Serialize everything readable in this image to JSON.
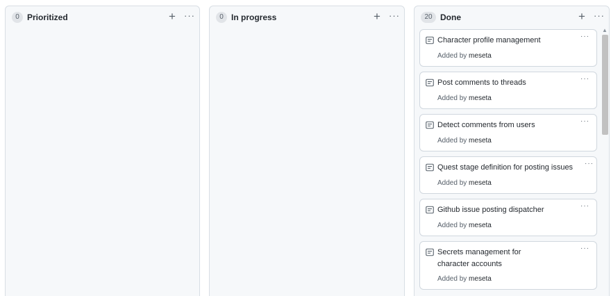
{
  "columns": [
    {
      "count": "0",
      "title": "Prioritized",
      "add": "+",
      "more": "···",
      "cards": []
    },
    {
      "count": "0",
      "title": "In progress",
      "add": "+",
      "more": "···",
      "cards": []
    },
    {
      "count": "20",
      "title": "Done",
      "add": "+",
      "more": "···",
      "cards": [
        {
          "title": "Character profile management",
          "added_by_label": "Added by",
          "author": "meseta",
          "menu": "···"
        },
        {
          "title": "Post comments to threads",
          "added_by_label": "Added by",
          "author": "meseta",
          "menu": "···"
        },
        {
          "title": "Detect comments from users",
          "added_by_label": "Added by",
          "author": "meseta",
          "menu": "···"
        },
        {
          "title": "Quest stage definition for posting issues",
          "added_by_label": "Added by",
          "author": "meseta",
          "menu": "···"
        },
        {
          "title": "Github issue posting dispatcher",
          "added_by_label": "Added by",
          "author": "meseta",
          "menu": "···"
        },
        {
          "title": "Secrets management for character accounts",
          "added_by_label": "Added by",
          "author": "meseta",
          "menu": "···"
        }
      ]
    }
  ],
  "icons": {
    "card": "note-icon",
    "scroll_up": "chevron-up-icon"
  },
  "colors": {
    "column_bg": "#f6f8fa",
    "border": "#d0d7de",
    "count_bg": "#e1e4e8",
    "muted": "#57606a",
    "text": "#24292f",
    "scroll_thumb": "#c1c1c1"
  }
}
